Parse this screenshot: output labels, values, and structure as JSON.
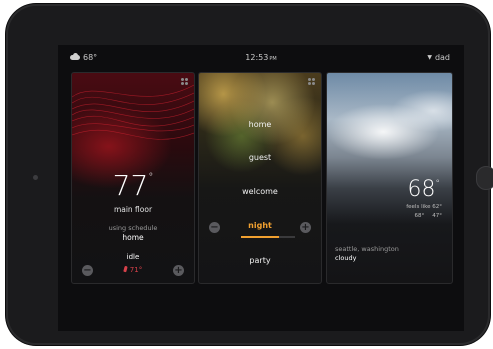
{
  "status_bar": {
    "weather_icon": "cloud-icon",
    "outdoor_temp": "68°",
    "time": "12:53",
    "ampm": "PM",
    "user_caret": "▼",
    "user": "dad"
  },
  "thermostat": {
    "current_temp": "77",
    "degree": "°",
    "zone": "main floor",
    "schedule_label": "using schedule",
    "schedule_value": "home",
    "mode": "idle",
    "setpoint": "71°",
    "minus": "−",
    "plus": "+"
  },
  "scenes": {
    "items": [
      "home",
      "guest",
      "welcome",
      "night",
      "party"
    ],
    "active": "night",
    "minus": "−",
    "plus": "+"
  },
  "weather": {
    "temp": "68",
    "degree": "°",
    "feels_like": "feels like 62°",
    "high": "68°",
    "low": "47°",
    "location": "seattle, washington",
    "condition": "cloudy"
  },
  "colors": {
    "accent_scene": "#f0a030",
    "heat_red": "#d6414a"
  }
}
